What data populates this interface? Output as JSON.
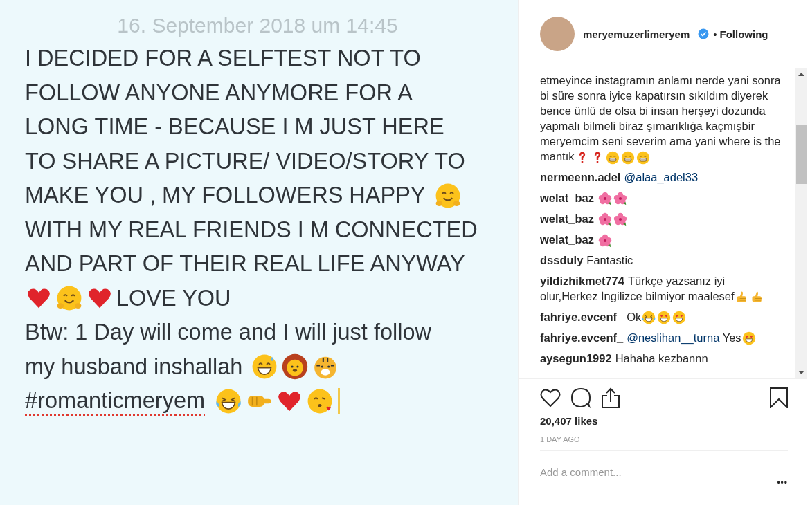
{
  "post_image": {
    "date": "16. September 2018 um 14:45",
    "lines": [
      [
        {
          "kind": "text",
          "text": "I DECIDED FOR A SELFTEST NOT TO"
        }
      ],
      [
        {
          "kind": "text",
          "text": "FOLLOW ANYONE ANYMORE FOR A"
        }
      ],
      [
        {
          "kind": "text",
          "text": "LONG TIME - BECAUSE I M JUST HERE"
        }
      ],
      [
        {
          "kind": "text",
          "text": "TO SHARE A PICTURE/ VIDEO/STORY TO"
        }
      ],
      [
        {
          "kind": "text",
          "text": "MAKE YOU , MY FOLLOWERS HAPPY"
        },
        {
          "kind": "hug"
        }
      ],
      [
        {
          "kind": "text",
          "text": "WITH MY REAL FRIENDS I M CONNECTED"
        }
      ],
      [
        {
          "kind": "text",
          "text": "AND PART OF THEIR REAL LIFE ANYWAY"
        }
      ],
      [
        {
          "kind": "heart"
        },
        {
          "kind": "hug"
        },
        {
          "kind": "heart"
        },
        {
          "kind": "text",
          "text": "LOVE YOU"
        }
      ],
      [
        {
          "kind": "text",
          "text": "Btw: 1 Day will come and I will just follow"
        }
      ],
      [
        {
          "kind": "text",
          "text": "my husband inshallah"
        },
        {
          "kind": "sweat"
        },
        {
          "kind": "lion"
        },
        {
          "kind": "tiger"
        }
      ],
      [
        {
          "kind": "hashtag",
          "text": "#romanticmeryem"
        },
        {
          "kind": "laugh"
        },
        {
          "kind": "fist"
        },
        {
          "kind": "heart"
        },
        {
          "kind": "kiss"
        },
        {
          "kind": "cursor"
        }
      ]
    ]
  },
  "header": {
    "username": "meryemuzerlimeryem",
    "verified": true,
    "separator": "•",
    "follow": "Following"
  },
  "comments": [
    {
      "parts": [
        {
          "kind": "text",
          "text": "etmeyince instagramın anlamı nerde yani sonra bi süre sonra iyice kapatırsın sıkıldım diyerek bence ünlü de olsa bi insan herşeyi dozunda yapmalı bilmeli biraz şımarıklığa kaçmışbir meryemcim seni severim ama yani where is the mantık"
        },
        {
          "kind": "question"
        },
        {
          "kind": "question"
        },
        {
          "kind": "grin"
        },
        {
          "kind": "grin"
        },
        {
          "kind": "grin"
        }
      ]
    },
    {
      "user": "nermeenn.adel",
      "parts": [
        {
          "kind": "mention",
          "text": "@alaa_adel33"
        }
      ]
    },
    {
      "user": "welat_baz",
      "parts": [
        {
          "kind": "flower"
        },
        {
          "kind": "flower"
        }
      ]
    },
    {
      "user": "welat_baz",
      "parts": [
        {
          "kind": "flower"
        },
        {
          "kind": "flower"
        }
      ]
    },
    {
      "user": "welat_baz",
      "parts": [
        {
          "kind": "flower"
        }
      ]
    },
    {
      "user": "dssduly",
      "parts": [
        {
          "kind": "text",
          "text": "Fantastic"
        }
      ]
    },
    {
      "user": "yildizhikmet774",
      "parts": [
        {
          "kind": "text",
          "text": "Türkçe yazsanız iyi olur,Herkez İngilizce bilmiyor maalesef"
        },
        {
          "kind": "thumbs"
        },
        {
          "kind": "thumbs"
        }
      ]
    },
    {
      "user": "fahriye.evcenf_",
      "parts": [
        {
          "kind": "text",
          "text": "Ok"
        },
        {
          "kind": "laugh"
        },
        {
          "kind": "hearteyes"
        },
        {
          "kind": "hearteyes"
        }
      ]
    },
    {
      "user": "fahriye.evcenf_",
      "parts": [
        {
          "kind": "mention",
          "text": "@neslihan__turna"
        },
        {
          "kind": "text",
          "text": "Yes"
        },
        {
          "kind": "hearteyes"
        }
      ]
    },
    {
      "user": "aysegun1992",
      "parts": [
        {
          "kind": "text",
          "text": "Hahaha kezbannn"
        }
      ]
    }
  ],
  "actions": {
    "liked": false,
    "saved": false
  },
  "likes": "20,407 likes",
  "time": "1 DAY AGO",
  "comment_input": {
    "placeholder": "Add a comment..."
  },
  "more": "•••"
}
